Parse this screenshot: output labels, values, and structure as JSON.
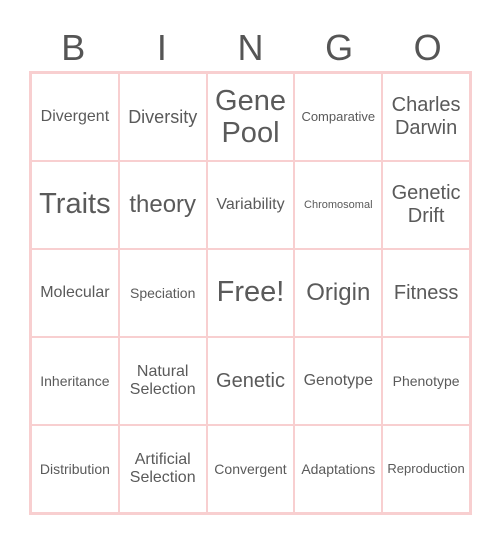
{
  "card": {
    "header_letters": [
      "B",
      "I",
      "N",
      "G",
      "O"
    ],
    "cells": [
      [
        "Divergent",
        "Diversity",
        "Gene Pool",
        "Comparative",
        "Charles Darwin"
      ],
      [
        "Traits",
        "theory",
        "Variability",
        "Chromosomal",
        "Genetic Drift"
      ],
      [
        "Molecular",
        "Speciation",
        "Free!",
        "Origin",
        "Fitness"
      ],
      [
        "Inheritance",
        "Natural Selection",
        "Genetic",
        "Genotype",
        "Phenotype"
      ],
      [
        "Distribution",
        "Artificial Selection",
        "Convergent",
        "Adaptations",
        "Reproduction"
      ]
    ],
    "free_cell": "Free!"
  },
  "colors": {
    "border": "#f8cfd0",
    "text": "#595959"
  }
}
